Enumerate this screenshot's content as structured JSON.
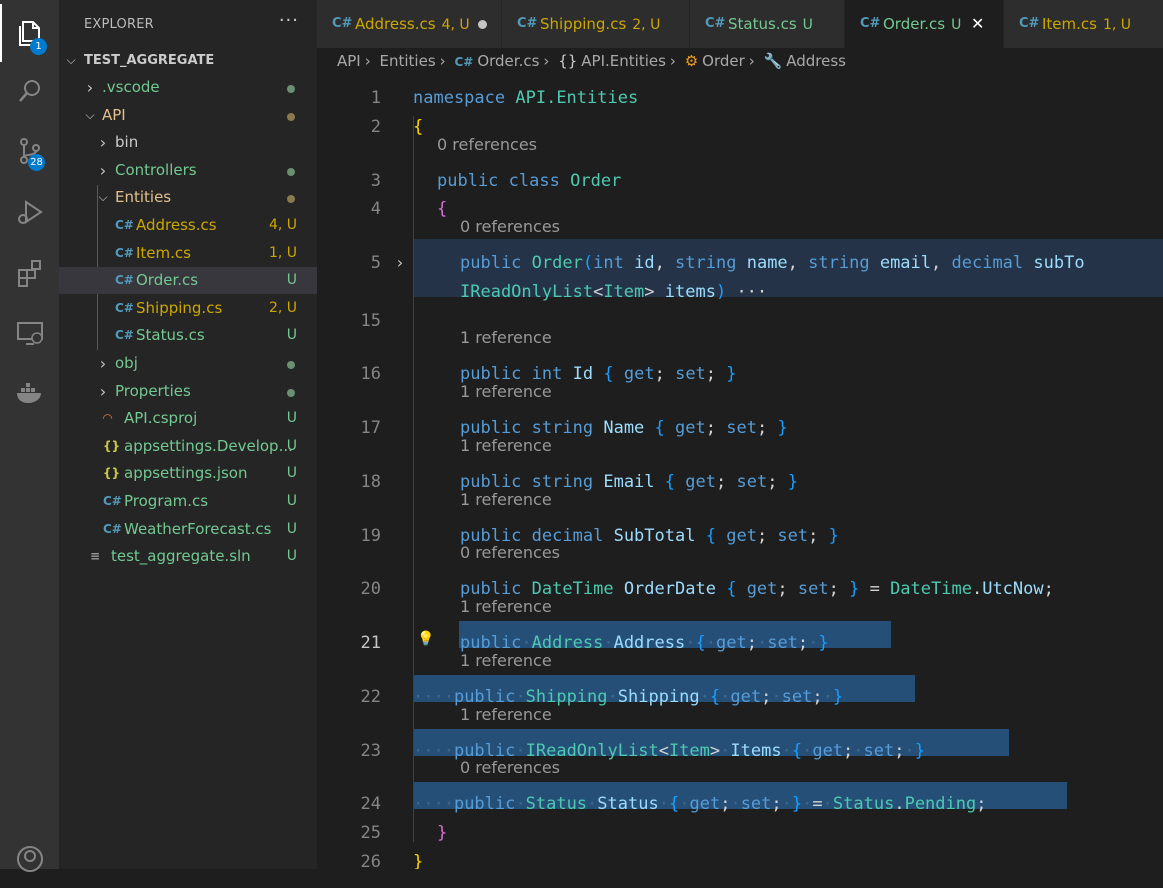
{
  "activity_bar": {
    "explorer_badge": "1",
    "scm_badge": "28"
  },
  "sidebar": {
    "title": "EXPLORER",
    "more": "···",
    "root": "TEST_AGGREGATE",
    "items": [
      {
        "label": ".vscode",
        "status": "",
        "color": "#73c991",
        "dot": "#6b8f71"
      },
      {
        "label": "API",
        "status": "",
        "color": "#e2c08d",
        "dot": "#8a7a4f"
      },
      {
        "label": "bin",
        "status": "",
        "color": "#cccccc",
        "dot": ""
      },
      {
        "label": "Controllers",
        "status": "",
        "color": "#73c991",
        "dot": "#6b8f71"
      },
      {
        "label": "Entities",
        "status": "",
        "color": "#e2c08d",
        "dot": "#8a7a4f"
      },
      {
        "label": "Address.cs",
        "status": "4, U",
        "color": "#cca700",
        "icon": "C#"
      },
      {
        "label": "Item.cs",
        "status": "1, U",
        "color": "#cca700",
        "icon": "C#"
      },
      {
        "label": "Order.cs",
        "status": "U",
        "color": "#73c991",
        "icon": "C#"
      },
      {
        "label": "Shipping.cs",
        "status": "2, U",
        "color": "#cca700",
        "icon": "C#"
      },
      {
        "label": "Status.cs",
        "status": "U",
        "color": "#73c991",
        "icon": "C#"
      },
      {
        "label": "obj",
        "status": "",
        "color": "#73c991",
        "dot": "#6b8f71"
      },
      {
        "label": "Properties",
        "status": "",
        "color": "#73c991",
        "dot": "#6b8f71"
      },
      {
        "label": "API.csproj",
        "status": "U",
        "color": "#73c991",
        "icon": "rss"
      },
      {
        "label": "appsettings.Develop...",
        "status": "U",
        "color": "#73c991",
        "icon": "{}"
      },
      {
        "label": "appsettings.json",
        "status": "U",
        "color": "#73c991",
        "icon": "{}"
      },
      {
        "label": "Program.cs",
        "status": "U",
        "color": "#73c991",
        "icon": "C#"
      },
      {
        "label": "WeatherForecast.cs",
        "status": "U",
        "color": "#73c991",
        "icon": "C#"
      },
      {
        "label": "test_aggregate.sln",
        "status": "U",
        "color": "#73c991",
        "icon": "sln"
      }
    ]
  },
  "tabs": [
    {
      "label": "Address.cs",
      "status": "4, U",
      "color": "#cca700",
      "modified": true
    },
    {
      "label": "Shipping.cs",
      "status": "2, U",
      "color": "#cca700"
    },
    {
      "label": "Status.cs",
      "status": "U",
      "color": "#73c991"
    },
    {
      "label": "Order.cs",
      "status": "U",
      "color": "#73c991",
      "active": true
    },
    {
      "label": "Item.cs",
      "status": "1, U",
      "color": "#cca700"
    }
  ],
  "breadcrumb": [
    "API",
    "Entities",
    "Order.cs",
    "API.Entities",
    "Order",
    "Address"
  ],
  "editor": {
    "line_numbers": [
      "1",
      "2",
      "3",
      "4",
      "5",
      "15",
      "16",
      "17",
      "18",
      "19",
      "20",
      "21",
      "22",
      "23",
      "24",
      "25",
      "26"
    ],
    "lens": {
      "zero": "0 references",
      "one": "1 reference"
    },
    "tokens": {
      "namespace": "namespace",
      "ns_name": "API.Entities",
      "public": "public",
      "class": "class",
      "Order": "Order",
      "int": "int",
      "string": "string",
      "decimal": "decimal",
      "id": "id",
      "name": "name",
      "email": "email",
      "subTo": "subTo",
      "IReadOnlyList": "IReadOnlyList",
      "Item": "Item",
      "items": "items",
      "ellipsis": "···",
      "Id": "Id",
      "Name": "Name",
      "Email": "Email",
      "SubTotal": "SubTotal",
      "DateTime": "DateTime",
      "OrderDate": "OrderDate",
      "UtcNow": "UtcNow",
      "Address": "Address",
      "Shipping": "Shipping",
      "Items": "Items",
      "Status": "Status",
      "Pending": "Pending",
      "get": "get",
      "set": "set"
    }
  }
}
